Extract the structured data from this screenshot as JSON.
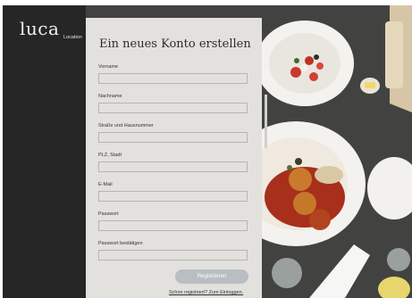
{
  "brand": {
    "logo": "luca",
    "location_label": "Location"
  },
  "form": {
    "title": "Ein neues Konto erstellen",
    "fields": [
      {
        "label": "Vorname",
        "value": ""
      },
      {
        "label": "Nachname",
        "value": ""
      },
      {
        "label": "Straße und Hausnummer",
        "value": ""
      },
      {
        "label": "PLZ, Stadt",
        "value": ""
      },
      {
        "label": "E-Mail",
        "value": ""
      },
      {
        "label": "Passwort",
        "value": ""
      },
      {
        "label": "Passwort bestätigen",
        "value": ""
      }
    ],
    "submit_label": "Registrieren",
    "login_link": "Schon registriert? Zum Einloggen."
  },
  "colors": {
    "sidebar": "#262626",
    "panel": "#e3e1dd",
    "button": "#b8bec2"
  }
}
